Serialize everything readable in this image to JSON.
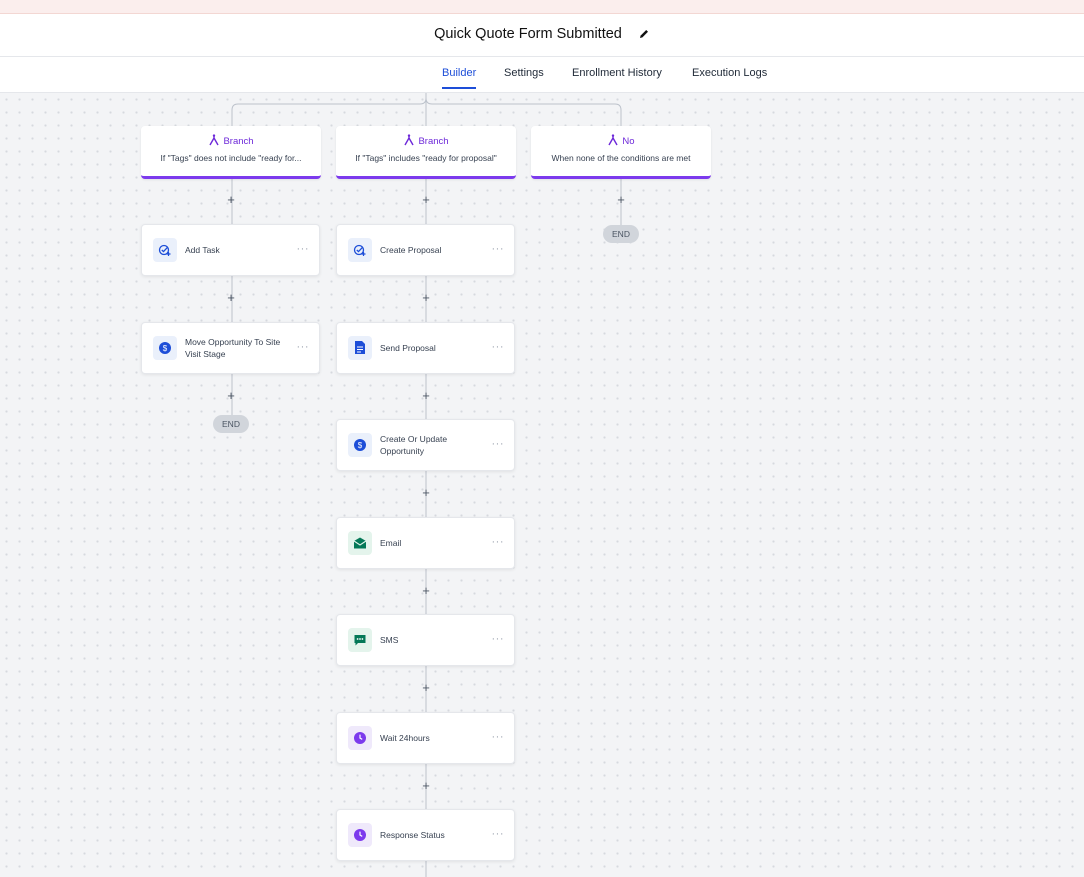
{
  "header": {
    "title": "Quick Quote Form Submitted"
  },
  "tabs": [
    {
      "label": "Builder",
      "active": true
    },
    {
      "label": "Settings",
      "active": false
    },
    {
      "label": "Enrollment History",
      "active": false
    },
    {
      "label": "Execution Logs",
      "active": false
    }
  ],
  "branches": [
    {
      "head": "Branch",
      "desc": "If \"Tags\" does not include \"ready for..."
    },
    {
      "head": "Branch",
      "desc": "If \"Tags\" includes \"ready for proposal\""
    },
    {
      "head": "No",
      "desc": "When none of the conditions are met"
    }
  ],
  "columns": [
    {
      "nodes": [
        {
          "label": "Add Task",
          "icon": "task-check-icon",
          "color": "blue"
        },
        {
          "label": "Move Opportunity To Site Visit Stage",
          "icon": "dollar-icon",
          "color": "blue"
        }
      ],
      "end_label": "END"
    },
    {
      "nodes": [
        {
          "label": "Create Proposal",
          "icon": "task-check-icon",
          "color": "blue"
        },
        {
          "label": "Send Proposal",
          "icon": "document-icon",
          "color": "blue"
        },
        {
          "label": "Create Or Update Opportunity",
          "icon": "dollar-icon",
          "color": "blue"
        },
        {
          "label": "Email",
          "icon": "email-icon",
          "color": "green"
        },
        {
          "label": "SMS",
          "icon": "sms-icon",
          "color": "green"
        },
        {
          "label": "Wait 24hours",
          "icon": "clock-icon",
          "color": "purple"
        },
        {
          "label": "Response Status",
          "icon": "clock-icon",
          "color": "purple"
        }
      ]
    },
    {
      "nodes": [],
      "end_label": "END"
    }
  ],
  "plus_label": "+",
  "menu_label": "···",
  "colors": {
    "accent": "#1d4ed8",
    "branch": "#7c3aed",
    "green": "#047857",
    "purple": "#7c3aed"
  }
}
